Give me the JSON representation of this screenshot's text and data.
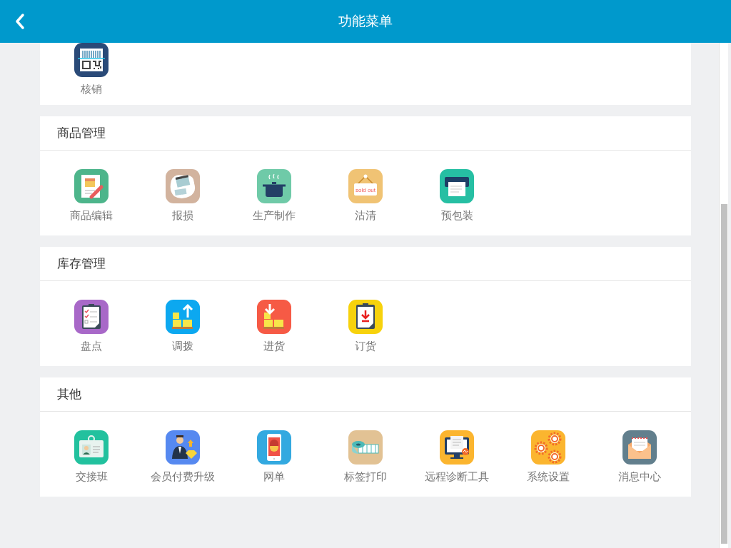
{
  "header": {
    "title": "功能菜单"
  },
  "sections": [
    {
      "items": [
        {
          "label": "核销",
          "kind": "barcode",
          "color": "#2a4a78"
        }
      ]
    },
    {
      "title": "商品管理",
      "items": [
        {
          "label": "商品编辑",
          "kind": "edit",
          "color": "#4db58b"
        },
        {
          "label": "报损",
          "kind": "torn",
          "color": "#d2b39e"
        },
        {
          "label": "生产制作",
          "kind": "pot",
          "color": "#6fcaa8"
        },
        {
          "label": "沽清",
          "kind": "soldout",
          "color": "#f0c374",
          "icon_text": "sold out"
        },
        {
          "label": "预包装",
          "kind": "printer",
          "color": "#26bfa3"
        }
      ]
    },
    {
      "title": "库存管理",
      "items": [
        {
          "label": "盘点",
          "kind": "checklist",
          "color": "#a868c8"
        },
        {
          "label": "调拨",
          "kind": "boxesup",
          "color": "#0ca8f0"
        },
        {
          "label": "进货",
          "kind": "boxesdown",
          "color": "#f65a45"
        },
        {
          "label": "订货",
          "kind": "clipdown",
          "color": "#f7d20c"
        }
      ]
    },
    {
      "title": "其他",
      "items": [
        {
          "label": "交接班",
          "kind": "badge",
          "color": "#22c19e"
        },
        {
          "label": "会员付费升级",
          "kind": "member",
          "color": "#5689f0"
        },
        {
          "label": "网单",
          "kind": "phone",
          "color": "#33a9e0"
        },
        {
          "label": "标签打印",
          "kind": "labelroll",
          "color": "#e2c294"
        },
        {
          "label": "远程诊断工具",
          "kind": "monitor",
          "color": "#fbb52f"
        },
        {
          "label": "系统设置",
          "kind": "gears",
          "color": "#fbb52f"
        },
        {
          "label": "消息中心",
          "kind": "envelope",
          "color": "#627f8d"
        }
      ]
    }
  ]
}
